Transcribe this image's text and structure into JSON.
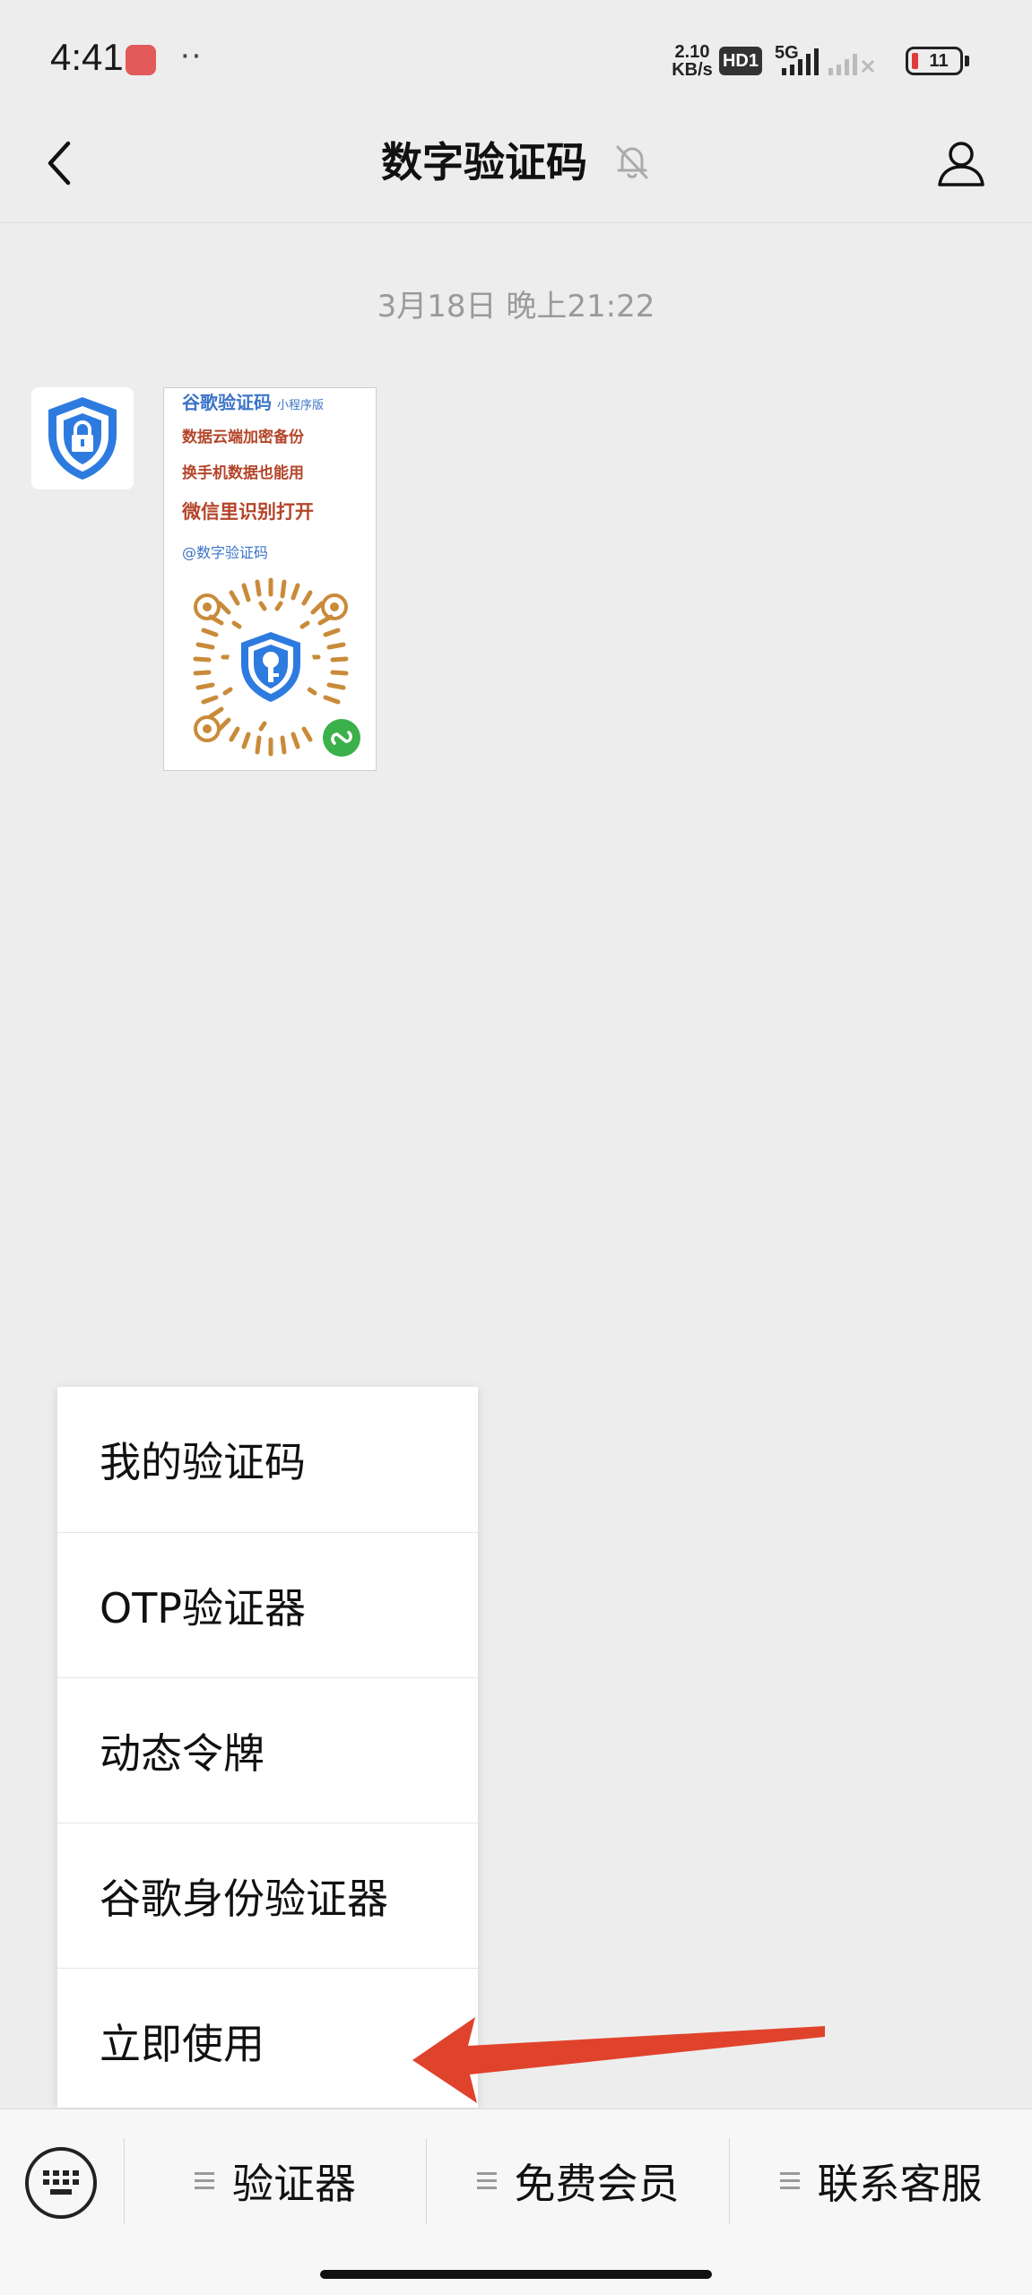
{
  "status_bar": {
    "time": "4:41",
    "dots": "··",
    "speed_value": "2.10",
    "speed_unit": "KB/s",
    "hd_label": "HD1",
    "network_label": "5G",
    "battery": "11",
    "battery_color": "#e03a3a"
  },
  "header": {
    "title": "数字验证码",
    "back_icon": "chevron-left-icon",
    "mute_icon": "bell-off-icon",
    "profile_icon": "person-icon"
  },
  "chat": {
    "timestamp": "3月18日 晚上21:22",
    "avatar_icon": "shield-lock-icon",
    "card": {
      "title": "谷歌验证码",
      "title_sub": "小程序版",
      "lines": [
        "数据云端加密备份",
        "换手机数据也能用"
      ],
      "headline": "微信里识别打开",
      "handle": "@数字验证码",
      "qr_icon": "mini-program-qr-code",
      "accent": "#3b74c7",
      "text_color": "#b4452a"
    }
  },
  "menu": {
    "items": [
      {
        "label": "我的验证码"
      },
      {
        "label": "OTP验证器"
      },
      {
        "label": "动态令牌"
      },
      {
        "label": "谷歌身份验证器"
      },
      {
        "label": "立即使用"
      }
    ]
  },
  "annotation": {
    "type": "red-arrow",
    "color": "#e0432c",
    "points_to": "立即使用"
  },
  "bottom_bar": {
    "keyboard_icon": "keyboard-icon",
    "tabs": [
      {
        "label": "验证器"
      },
      {
        "label": "免费会员"
      },
      {
        "label": "联系客服"
      }
    ]
  }
}
